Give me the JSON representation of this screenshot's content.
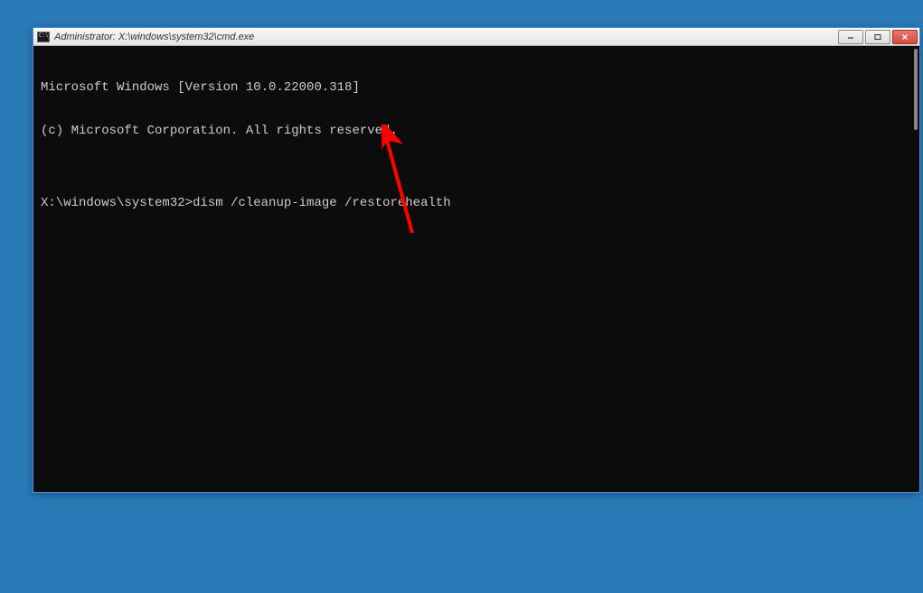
{
  "window": {
    "title": "Administrator: X:\\windows\\system32\\cmd.exe"
  },
  "terminal": {
    "line1": "Microsoft Windows [Version 10.0.22000.318]",
    "line2": "(c) Microsoft Corporation. All rights reserved.",
    "blank": "",
    "prompt": "X:\\windows\\system32>",
    "command": "dism /cleanup-image /restorehealth"
  },
  "colors": {
    "desktop_bg": "#2a7ab8",
    "terminal_bg": "#0c0c0c",
    "terminal_fg": "#cccccc",
    "arrow": "#ff0000"
  }
}
